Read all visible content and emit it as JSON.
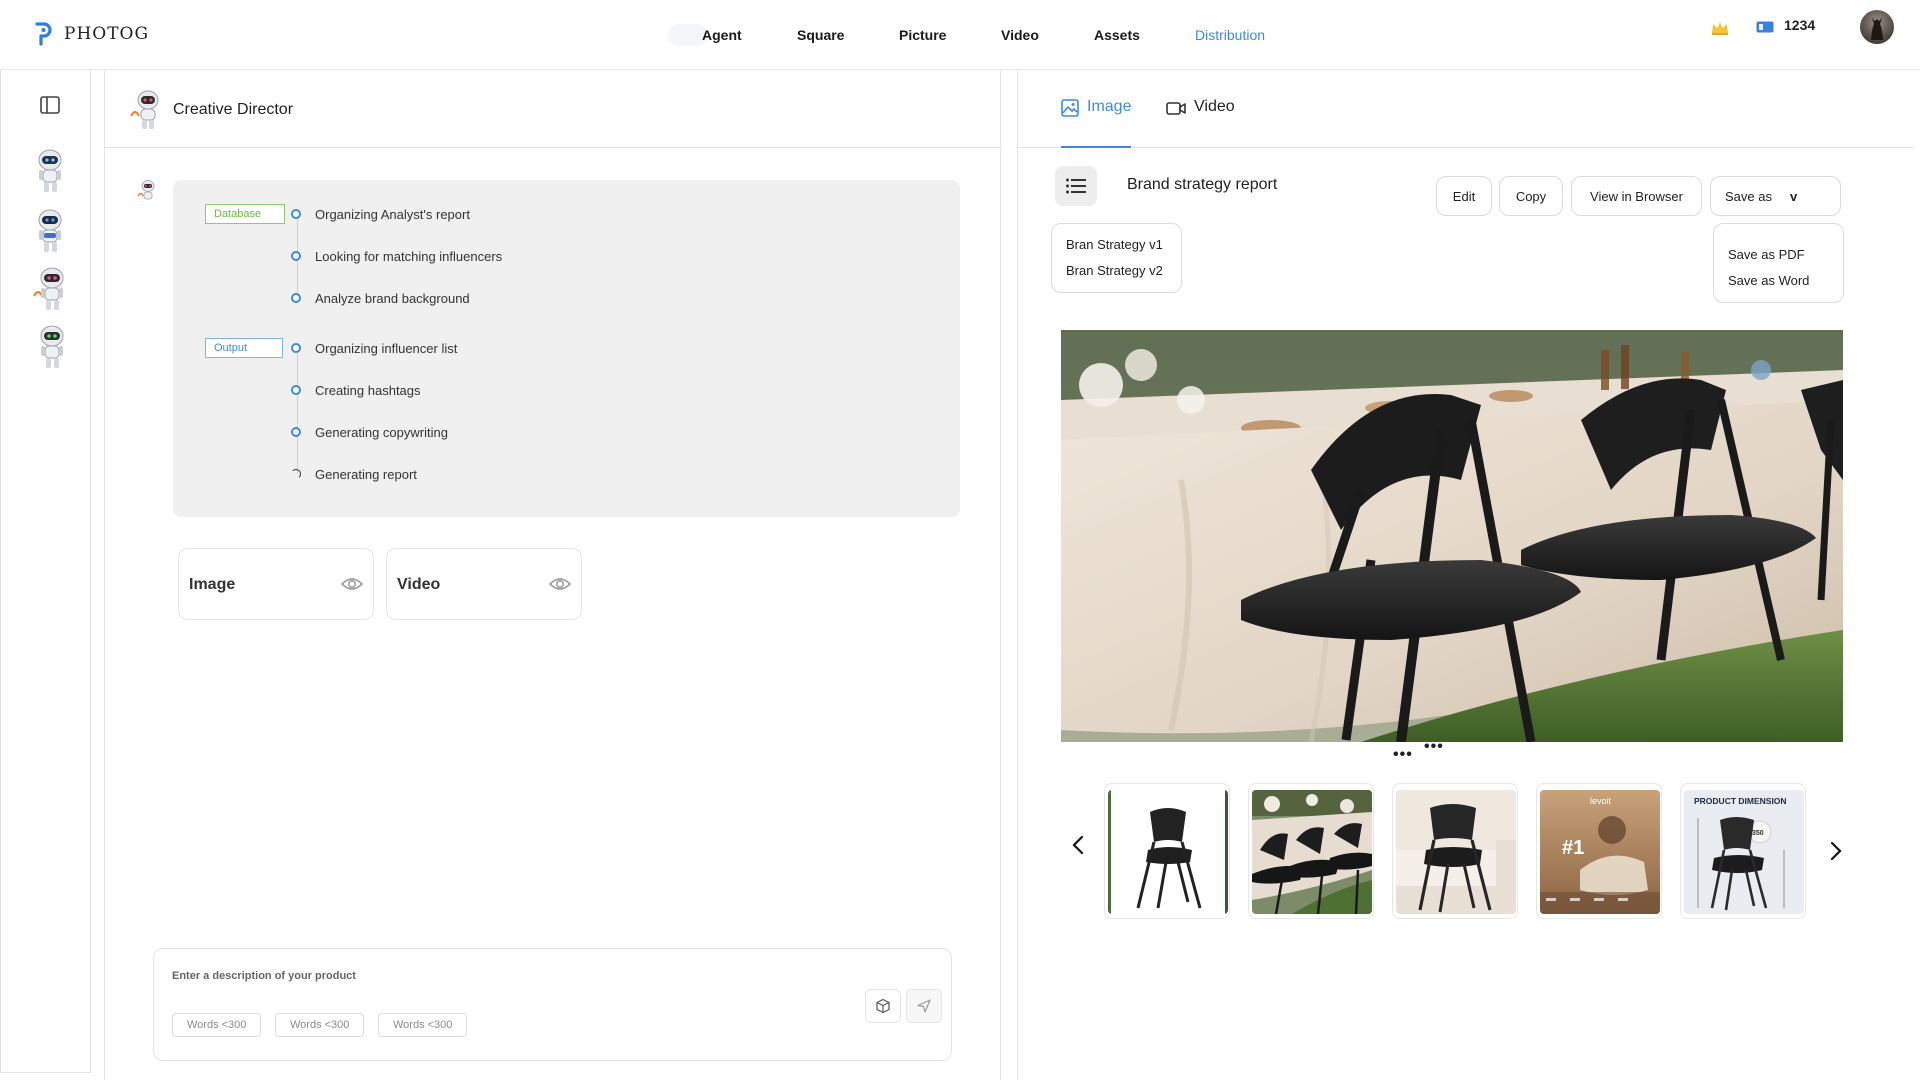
{
  "app": {
    "brand": "PHOTOG"
  },
  "nav": {
    "items": [
      {
        "label": "Agent",
        "active": false
      },
      {
        "label": "Square",
        "active": false
      },
      {
        "label": "Picture",
        "active": false
      },
      {
        "label": "Video",
        "active": false
      },
      {
        "label": "Assets",
        "active": false
      },
      {
        "label": "Distribution",
        "active": true
      }
    ],
    "credits": "1234"
  },
  "rail": {
    "agents": [
      "robot-agent-1",
      "robot-agent-2",
      "robot-agent-3",
      "robot-agent-4"
    ]
  },
  "chat": {
    "title": "Creative Director",
    "tags": {
      "database": "Database",
      "output": "Output"
    },
    "steps": [
      {
        "label": "Organizing Analyst's report",
        "status": "done"
      },
      {
        "label": "Looking for matching influencers",
        "status": "done"
      },
      {
        "label": "Analyze brand background",
        "status": "done"
      },
      {
        "label": "Organizing influencer list",
        "status": "done"
      },
      {
        "label": "Creating hashtags",
        "status": "done"
      },
      {
        "label": "Generating copywriting",
        "status": "done"
      },
      {
        "label": "Generating report",
        "status": "in-progress"
      }
    ],
    "media_cards": [
      {
        "label": "Image"
      },
      {
        "label": "Video"
      }
    ],
    "composer": {
      "placeholder": "Enter a description of your product",
      "chips": [
        "Words <300",
        "Words <300",
        "Words <300"
      ]
    }
  },
  "preview": {
    "tabs": [
      {
        "label": "Image",
        "active": true
      },
      {
        "label": "Video",
        "active": false
      }
    ],
    "report_title": "Brand strategy report",
    "buttons": {
      "edit": "Edit",
      "copy": "Copy",
      "view_in_browser": "View in Browser",
      "save_as": "Save as",
      "save_as_chevron": "v"
    },
    "versions": [
      "Bran Strategy v1",
      "Bran Strategy v2"
    ],
    "save_options": [
      "Save as PDF",
      "Save as Word"
    ],
    "thumbnails": [
      {
        "kind": "chair-white-bg"
      },
      {
        "kind": "chairs-outdoor-table"
      },
      {
        "kind": "chair-indoor"
      },
      {
        "kind": "levoit-ad",
        "brand": "levoit",
        "badge": "#1"
      },
      {
        "kind": "product-dimension",
        "heading": "PRODUCT DIMENSION",
        "badge": "350"
      }
    ],
    "accent": "#3b8be0"
  }
}
